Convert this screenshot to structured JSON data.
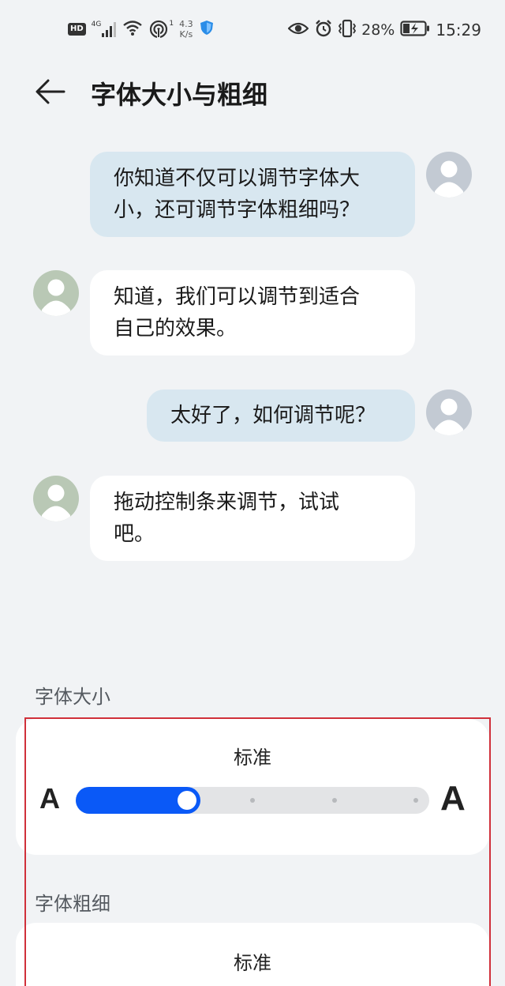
{
  "status_bar": {
    "hd_badge": "HD",
    "network_type": "4G",
    "hotspot_count": "1",
    "net_speed_value": "4.3",
    "net_speed_unit": "K/s",
    "battery_percent": "28%",
    "time": "15:29",
    "icons": [
      "signal-icon",
      "wifi-icon",
      "hotspot-icon",
      "shield-icon",
      "eye-icon",
      "alarm-icon",
      "vibrate-icon",
      "battery-charging-icon"
    ]
  },
  "header": {
    "title": "字体大小与粗细",
    "back_icon": "arrow-left-icon"
  },
  "chat": {
    "messages": [
      {
        "side": "out",
        "lines": [
          "你知道不仅可以调节字体大",
          "小，还可调节字体粗细吗？"
        ]
      },
      {
        "side": "in",
        "lines": [
          "知道，我们可以调节到适合",
          "自己的效果。"
        ]
      },
      {
        "side": "out",
        "lines": [
          "太好了，如何调节呢？"
        ]
      },
      {
        "side": "in",
        "lines": [
          "拖动控制条来调节，试试",
          "吧。"
        ]
      }
    ],
    "colors": {
      "outgoing_bubble": "#d8e7f0",
      "incoming_bubble": "#ffffff"
    }
  },
  "font_size": {
    "label": "字体大小",
    "value_label": "标准",
    "small_a": "A",
    "large_a": "A",
    "slider_level": 0.25,
    "slider_steps": 5,
    "accent_color": "#0a59f7"
  },
  "font_weight": {
    "label": "字体粗细",
    "value_label": "标准"
  }
}
